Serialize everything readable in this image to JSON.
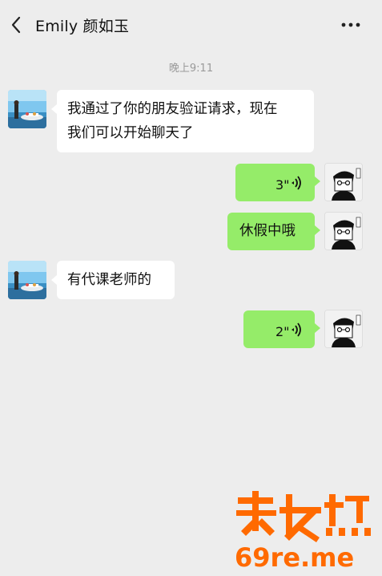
{
  "header": {
    "title": "Emily 颜如玉"
  },
  "timestamp": "晚上9:11",
  "messages": [
    {
      "from": "contact",
      "type": "text",
      "lines": [
        "我通过了你的朋友验证请求，现在",
        "我们可以开始聊天了"
      ]
    },
    {
      "from": "me",
      "type": "voice",
      "duration": "3\""
    },
    {
      "from": "me",
      "type": "text",
      "lines": [
        "休假中哦"
      ]
    },
    {
      "from": "contact",
      "type": "text",
      "lines": [
        "有代课老师的"
      ]
    },
    {
      "from": "me",
      "type": "voice",
      "duration": "2\""
    }
  ],
  "colors": {
    "background": "#ededed",
    "my_bubble": "#95ec69",
    "their_bubble": "#ffffff",
    "watermark": "#ff6a00"
  },
  "icons": {
    "back": "chevron-left-icon",
    "more": "more-dots-icon",
    "voice": "voice-wave-icon"
  }
}
